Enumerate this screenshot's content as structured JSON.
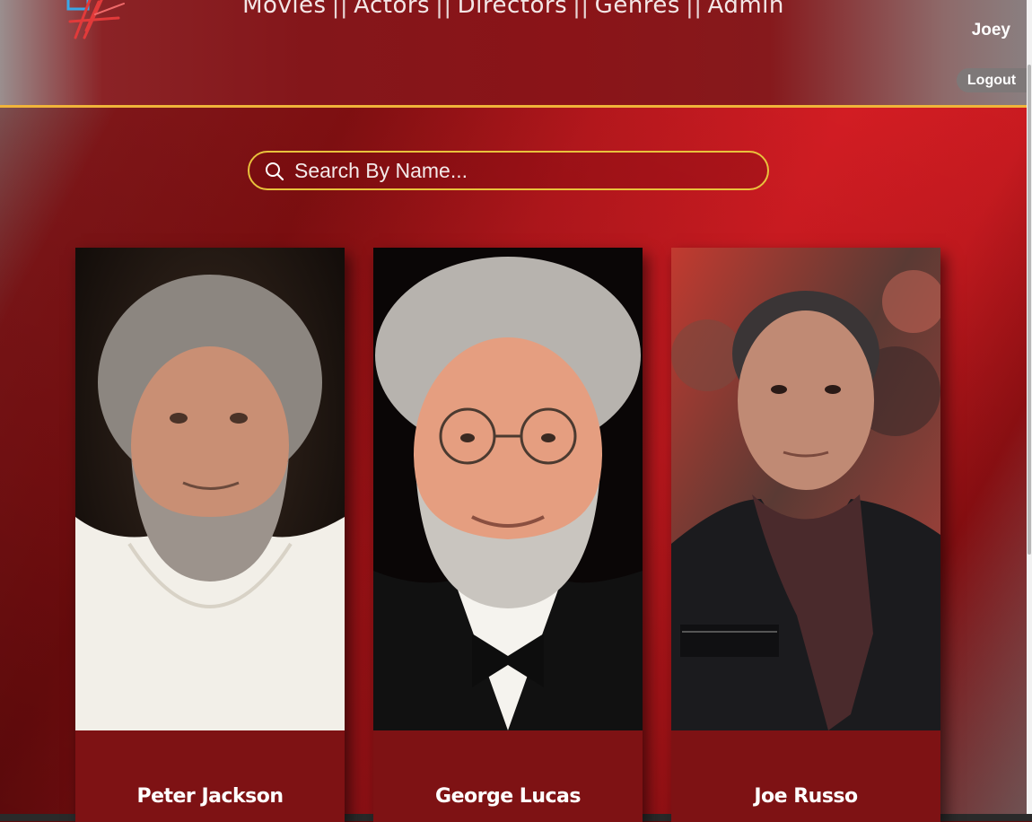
{
  "header": {
    "nav": [
      "Movies",
      "Actors",
      "Directors",
      "Genres",
      "Admin"
    ],
    "separator": "||",
    "username": "Joey",
    "logout_label": "Logout"
  },
  "search": {
    "placeholder": "Search By Name..."
  },
  "directors": [
    {
      "name": "Peter Jackson"
    },
    {
      "name": "George Lucas"
    },
    {
      "name": "Joe Russo"
    }
  ],
  "colors": {
    "header_border": "#f0b43a",
    "search_border": "#e9c23c",
    "card_background": "#7e1214",
    "accent_red": "#de1f26"
  }
}
